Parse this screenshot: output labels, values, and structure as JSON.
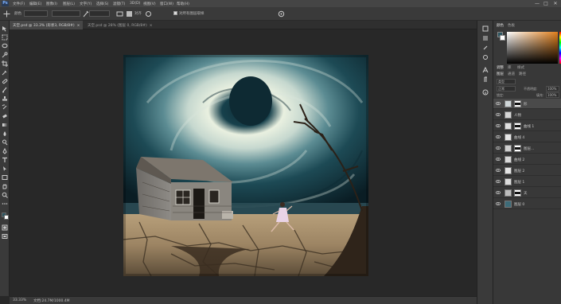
{
  "menubar": {
    "items": [
      "文件(F)",
      "编辑(E)",
      "图像(I)",
      "图层(L)",
      "文字(Y)",
      "选择(S)",
      "滤镜(T)",
      "3D(D)",
      "视图(V)",
      "窗口(W)",
      "帮助(H)"
    ],
    "window_controls": [
      "—",
      "□",
      "✕"
    ]
  },
  "options": {
    "brush_label": "颜色",
    "field_1": "",
    "field_2": "",
    "field_3": "",
    "option_label": "对齐",
    "sample_checkbox_label": "对所有图层取样"
  },
  "tabs": [
    {
      "label": "天空.psd @ 33.3% (形状3, RGB/8#)",
      "close": "×"
    },
    {
      "label": "天空.psd @ 28% (图层 0, RGB/8#)",
      "close": "×"
    }
  ],
  "statusbar": {
    "zoom": "33.33%",
    "doc_info": "文档:24.7M/1000.4M"
  },
  "panels": {
    "color_tabs": [
      "颜色",
      "色板"
    ],
    "adjust_tabs": [
      "调整",
      "库",
      "样式"
    ],
    "layers_tabs": [
      "图层",
      "通道",
      "路径"
    ],
    "filter_kind": "类型",
    "blend_mode": "正常",
    "opacity_label": "不透明度:",
    "opacity_value": "100%",
    "lock_label": "锁定:",
    "fill_label": "填充:",
    "fill_value": "100%"
  },
  "layers": [
    {
      "name": "形",
      "selected": true,
      "has_mask": true,
      "thumb": "#cfd6d8"
    },
    {
      "name": "人物",
      "selected": false,
      "has_mask": false,
      "thumb": "#d6d6d6"
    },
    {
      "name": "曲线 1",
      "selected": false,
      "has_mask": true,
      "thumb": "#e0e0e0"
    },
    {
      "name": "曲线 4",
      "selected": false,
      "has_mask": false,
      "thumb": "#e6e6e6"
    },
    {
      "name": "图层...",
      "selected": false,
      "has_mask": true,
      "thumb": "#cfcfcf"
    },
    {
      "name": "曲线 2",
      "selected": false,
      "has_mask": false,
      "thumb": "#d9d9d9"
    },
    {
      "name": "图层 2",
      "selected": false,
      "has_mask": false,
      "thumb": "#e4e4e4"
    },
    {
      "name": "图层 1",
      "selected": false,
      "has_mask": false,
      "thumb": "#dcdcdc"
    },
    {
      "name": "天",
      "selected": false,
      "has_mask": true,
      "thumb": "#bdbdbd"
    },
    {
      "name": "图层 0",
      "selected": false,
      "has_mask": false,
      "thumb": "#3d6b78"
    }
  ],
  "colors": {
    "foreground": "#2d5560",
    "background": "#ffffff",
    "accent_orange": "#e07f1c"
  }
}
